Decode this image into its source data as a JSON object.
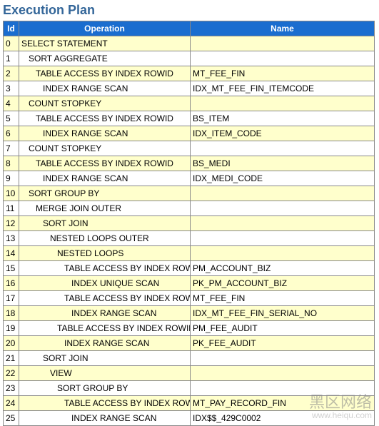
{
  "title": "Execution Plan",
  "columns": {
    "id": "Id",
    "operation": "Operation",
    "name": "Name"
  },
  "rows": [
    {
      "id": "0",
      "indent": 0,
      "op": "SELECT STATEMENT",
      "name": ""
    },
    {
      "id": "1",
      "indent": 1,
      "op": "SORT AGGREGATE",
      "name": ""
    },
    {
      "id": "2",
      "indent": 2,
      "op": "TABLE ACCESS BY INDEX ROWID",
      "name": "MT_FEE_FIN"
    },
    {
      "id": "3",
      "indent": 3,
      "op": "INDEX RANGE SCAN",
      "name": "IDX_MT_FEE_FIN_ITEMCODE"
    },
    {
      "id": "4",
      "indent": 1,
      "op": "COUNT STOPKEY",
      "name": ""
    },
    {
      "id": "5",
      "indent": 2,
      "op": "TABLE ACCESS BY INDEX ROWID",
      "name": "BS_ITEM"
    },
    {
      "id": "6",
      "indent": 3,
      "op": "INDEX RANGE SCAN",
      "name": "IDX_ITEM_CODE"
    },
    {
      "id": "7",
      "indent": 1,
      "op": "COUNT STOPKEY",
      "name": ""
    },
    {
      "id": "8",
      "indent": 2,
      "op": "TABLE ACCESS BY INDEX ROWID",
      "name": "BS_MEDI"
    },
    {
      "id": "9",
      "indent": 3,
      "op": "INDEX RANGE SCAN",
      "name": "IDX_MEDI_CODE"
    },
    {
      "id": "10",
      "indent": 1,
      "op": "SORT GROUP BY",
      "name": ""
    },
    {
      "id": "11",
      "indent": 2,
      "op": "MERGE JOIN OUTER",
      "name": ""
    },
    {
      "id": "12",
      "indent": 3,
      "op": "SORT JOIN",
      "name": ""
    },
    {
      "id": "13",
      "indent": 4,
      "op": "NESTED LOOPS OUTER",
      "name": ""
    },
    {
      "id": "14",
      "indent": 5,
      "op": "NESTED LOOPS",
      "name": ""
    },
    {
      "id": "15",
      "indent": 6,
      "op": "TABLE ACCESS BY INDEX ROWID",
      "name": "PM_ACCOUNT_BIZ"
    },
    {
      "id": "16",
      "indent": 7,
      "op": "INDEX UNIQUE SCAN",
      "name": "PK_PM_ACCOUNT_BIZ"
    },
    {
      "id": "17",
      "indent": 6,
      "op": "TABLE ACCESS BY INDEX ROWID",
      "name": "MT_FEE_FIN"
    },
    {
      "id": "18",
      "indent": 7,
      "op": "INDEX RANGE SCAN",
      "name": "IDX_MT_FEE_FIN_SERIAL_NO"
    },
    {
      "id": "19",
      "indent": 5,
      "op": "TABLE ACCESS BY INDEX ROWID",
      "name": "PM_FEE_AUDIT"
    },
    {
      "id": "20",
      "indent": 6,
      "op": "INDEX RANGE SCAN",
      "name": "PK_FEE_AUDIT"
    },
    {
      "id": "21",
      "indent": 3,
      "op": "SORT JOIN",
      "name": ""
    },
    {
      "id": "22",
      "indent": 4,
      "op": "VIEW",
      "name": ""
    },
    {
      "id": "23",
      "indent": 5,
      "op": "SORT GROUP BY",
      "name": ""
    },
    {
      "id": "24",
      "indent": 6,
      "op": "TABLE ACCESS BY INDEX ROWID",
      "name": "MT_PAY_RECORD_FIN"
    },
    {
      "id": "25",
      "indent": 7,
      "op": "INDEX RANGE SCAN",
      "name": "IDX$$_429C0002"
    }
  ],
  "watermark": {
    "main": "黑区网络",
    "sub": "www.heiqu.com"
  }
}
